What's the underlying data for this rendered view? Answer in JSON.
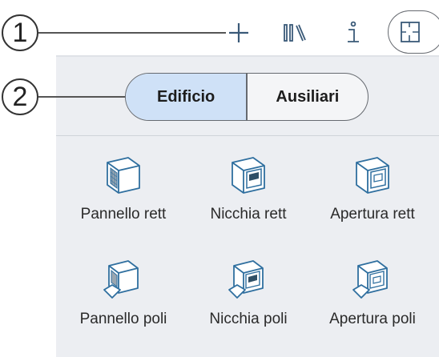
{
  "callouts": [
    "1",
    "2"
  ],
  "toolbar": {
    "icons": [
      "plus-icon",
      "library-icon",
      "info-icon",
      "floorplan-icon"
    ]
  },
  "tabs": [
    {
      "label": "Edificio",
      "active": true
    },
    {
      "label": "Ausiliari",
      "active": false
    }
  ],
  "tools": [
    {
      "label": "Pannello rett",
      "icon": "rect-panel-icon"
    },
    {
      "label": "Nicchia rett",
      "icon": "rect-niche-icon"
    },
    {
      "label": "Apertura rett",
      "icon": "rect-opening-icon"
    },
    {
      "label": "Pannello poli",
      "icon": "poly-panel-icon"
    },
    {
      "label": "Nicchia poli",
      "icon": "poly-niche-icon"
    },
    {
      "label": "Apertura poli",
      "icon": "poly-opening-icon"
    }
  ],
  "colors": {
    "accent": "#cfe1f7",
    "icon_stroke": "#2f6f9f",
    "panel_bg": "#eceef2"
  }
}
